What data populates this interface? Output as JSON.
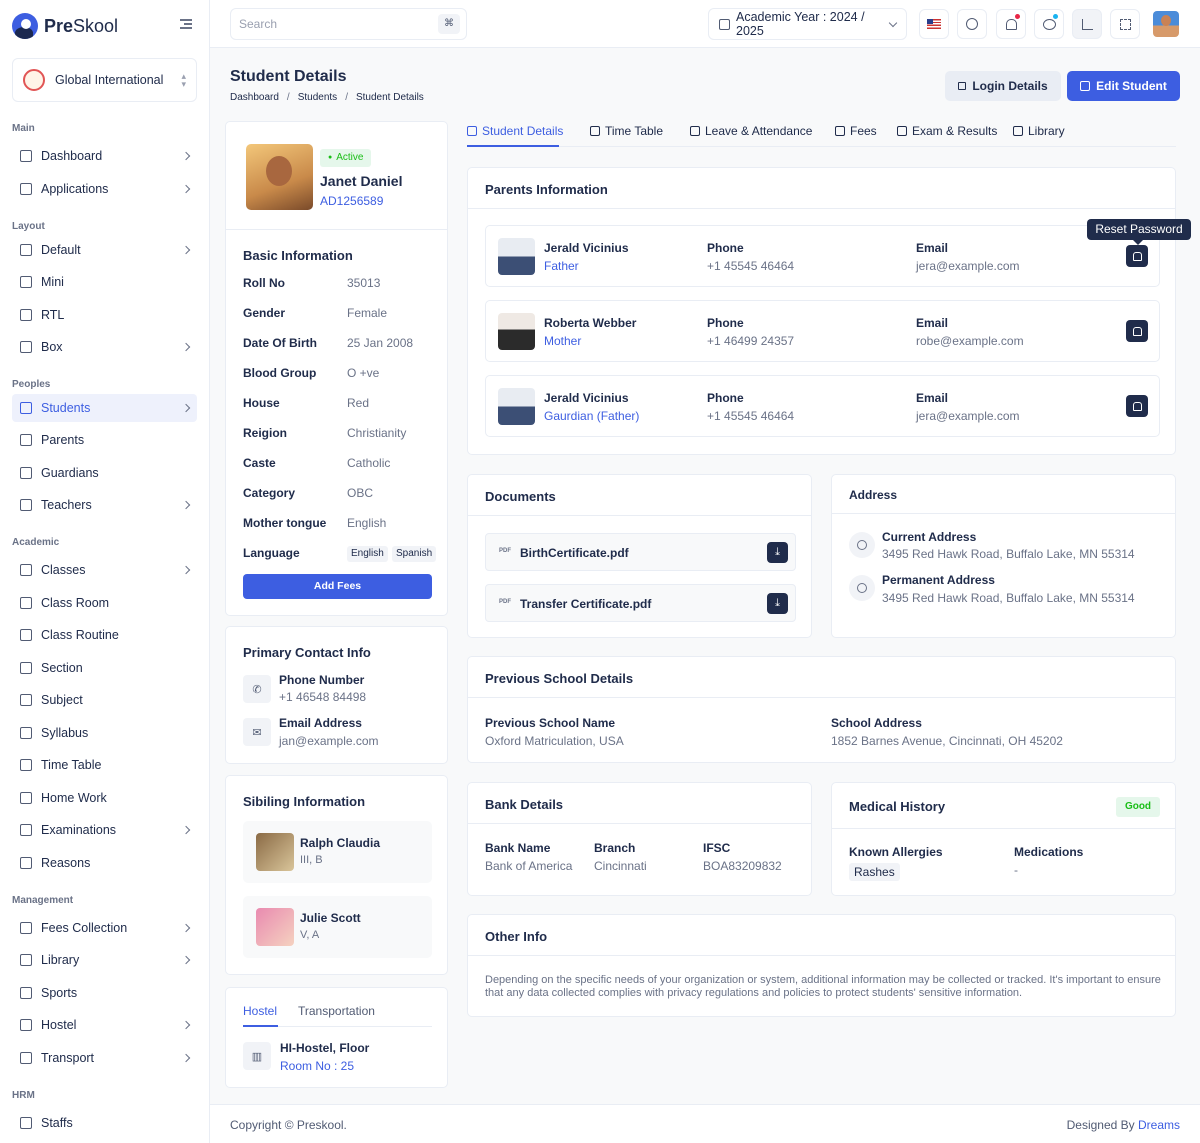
{
  "app": {
    "brand_bold": "Pre",
    "brand_rest": "Skool"
  },
  "school": {
    "name": "Global International"
  },
  "sidebar": {
    "sections": [
      "Main",
      "Layout",
      "Peoples",
      "Academic",
      "Management",
      "HRM"
    ],
    "items": [
      {
        "label": "Dashboard",
        "chevron": true,
        "active": false
      },
      {
        "label": "Applications",
        "chevron": true,
        "active": false
      },
      {
        "label": "Default",
        "chevron": true,
        "active": false
      },
      {
        "label": "Mini",
        "chevron": false,
        "active": false
      },
      {
        "label": "RTL",
        "chevron": false,
        "active": false
      },
      {
        "label": "Box",
        "chevron": true,
        "active": false
      },
      {
        "label": "Students",
        "chevron": true,
        "active": true
      },
      {
        "label": "Parents",
        "chevron": false,
        "active": false
      },
      {
        "label": "Guardians",
        "chevron": false,
        "active": false
      },
      {
        "label": "Teachers",
        "chevron": true,
        "active": false
      },
      {
        "label": "Classes",
        "chevron": true,
        "active": false
      },
      {
        "label": "Class Room",
        "chevron": false,
        "active": false
      },
      {
        "label": "Class Routine",
        "chevron": false,
        "active": false
      },
      {
        "label": "Section",
        "chevron": false,
        "active": false
      },
      {
        "label": "Subject",
        "chevron": false,
        "active": false
      },
      {
        "label": "Syllabus",
        "chevron": false,
        "active": false
      },
      {
        "label": "Time Table",
        "chevron": false,
        "active": false
      },
      {
        "label": "Home Work",
        "chevron": false,
        "active": false
      },
      {
        "label": "Examinations",
        "chevron": true,
        "active": false
      },
      {
        "label": "Reasons",
        "chevron": false,
        "active": false
      },
      {
        "label": "Fees Collection",
        "chevron": true,
        "active": false
      },
      {
        "label": "Library",
        "chevron": true,
        "active": false
      },
      {
        "label": "Sports",
        "chevron": false,
        "active": false
      },
      {
        "label": "Hostel",
        "chevron": true,
        "active": false
      },
      {
        "label": "Transport",
        "chevron": true,
        "active": false
      },
      {
        "label": "Staffs",
        "chevron": false,
        "active": false
      }
    ]
  },
  "topbar": {
    "search_placeholder": "Search",
    "search_shortcut": "⌘",
    "academic_year": "Academic Year : 2024 / 2025"
  },
  "header": {
    "title": "Student Details",
    "breadcrumb": [
      "Dashboard",
      "Students",
      "Student Details"
    ],
    "login_button": "Login Details",
    "edit_button": "Edit Student"
  },
  "profile": {
    "status": "Active",
    "name": "Janet  Daniel",
    "admission_no": "AD1256589"
  },
  "basic_info": {
    "title": "Basic Information",
    "rows": [
      {
        "label": "Roll No",
        "value": "35013"
      },
      {
        "label": "Gender",
        "value": "Female"
      },
      {
        "label": "Date Of Birth",
        "value": "25 Jan 2008"
      },
      {
        "label": "Blood Group",
        "value": "O +ve"
      },
      {
        "label": "House",
        "value": "Red"
      },
      {
        "label": "Reigion",
        "value": "Christianity"
      },
      {
        "label": "Caste",
        "value": "Catholic"
      },
      {
        "label": "Category",
        "value": "OBC"
      },
      {
        "label": "Mother tongue",
        "value": "English"
      }
    ],
    "language_label": "Language",
    "languages": [
      "English",
      "Spanish"
    ],
    "add_fees_button": "Add Fees"
  },
  "primary_contact": {
    "title": "Primary Contact Info",
    "phone_label": "Phone Number",
    "phone": "+1 46548 84498",
    "email_label": "Email Address",
    "email": "jan@example.com"
  },
  "siblings": {
    "title": "Sibiling Information",
    "items": [
      {
        "name": "Ralph Claudia",
        "class": "III, B"
      },
      {
        "name": "Julie Scott",
        "class": "V, A"
      }
    ]
  },
  "hostel": {
    "tabs": [
      "Hostel",
      "Transportation"
    ],
    "name": "HI-Hostel, Floor",
    "room": "Room No : 25"
  },
  "tabs": [
    "Student Details",
    "Time Table",
    "Leave & Attendance",
    "Fees",
    "Exam & Results",
    "Library"
  ],
  "parents": {
    "title": "Parents Information",
    "tooltip": "Reset Password",
    "phone_label": "Phone",
    "email_label": "Email",
    "items": [
      {
        "name": "Jerald Vicinius",
        "relation": "Father",
        "phone": "+1 45545 46464",
        "email": "jera@example.com"
      },
      {
        "name": "Roberta Webber",
        "relation": "Mother",
        "phone": "+1 46499 24357",
        "email": "robe@example.com"
      },
      {
        "name": "Jerald Vicinius",
        "relation": "Gaurdian (Father)",
        "phone": "+1 45545 46464",
        "email": "jera@example.com"
      }
    ]
  },
  "documents": {
    "title": "Documents",
    "pdf_tag": "PDF",
    "items": [
      "BirthCertificate.pdf",
      "Transfer Certificate.pdf"
    ]
  },
  "address": {
    "title": "Address",
    "current_label": "Current Address",
    "current": "3495 Red Hawk Road, Buffalo Lake, MN 55314",
    "permanent_label": "Permanent Address",
    "permanent": "3495 Red Hawk Road, Buffalo Lake, MN 55314"
  },
  "previous_school": {
    "title": "Previous School Details",
    "name_label": "Previous School Name",
    "name": "Oxford Matriculation, USA",
    "address_label": "School Address",
    "address": "1852 Barnes Avenue, Cincinnati, OH 45202"
  },
  "bank": {
    "title": "Bank Details",
    "name_label": "Bank Name",
    "name": "Bank of America",
    "branch_label": "Branch",
    "branch": "Cincinnati",
    "ifsc_label": "IFSC",
    "ifsc": "BOA83209832"
  },
  "medical": {
    "title": "Medical History",
    "status": "Good",
    "allergies_label": "Known Allergies",
    "allergies": "Rashes",
    "medications_label": "Medications",
    "medications": "-"
  },
  "other_info": {
    "title": "Other Info",
    "text": "Depending on the specific needs of your organization or system, additional information may be collected or tracked. It's important to ensure that any data collected complies with privacy regulations and policies to protect students' sensitive information."
  },
  "footer": {
    "copyright": "Copyright © Preskool.",
    "designed_by": "Designed By ",
    "designer": "Dreams"
  },
  "colors": {
    "primary": "#3d5ee1",
    "dark": "#202c4b",
    "success": "#1abe17"
  }
}
